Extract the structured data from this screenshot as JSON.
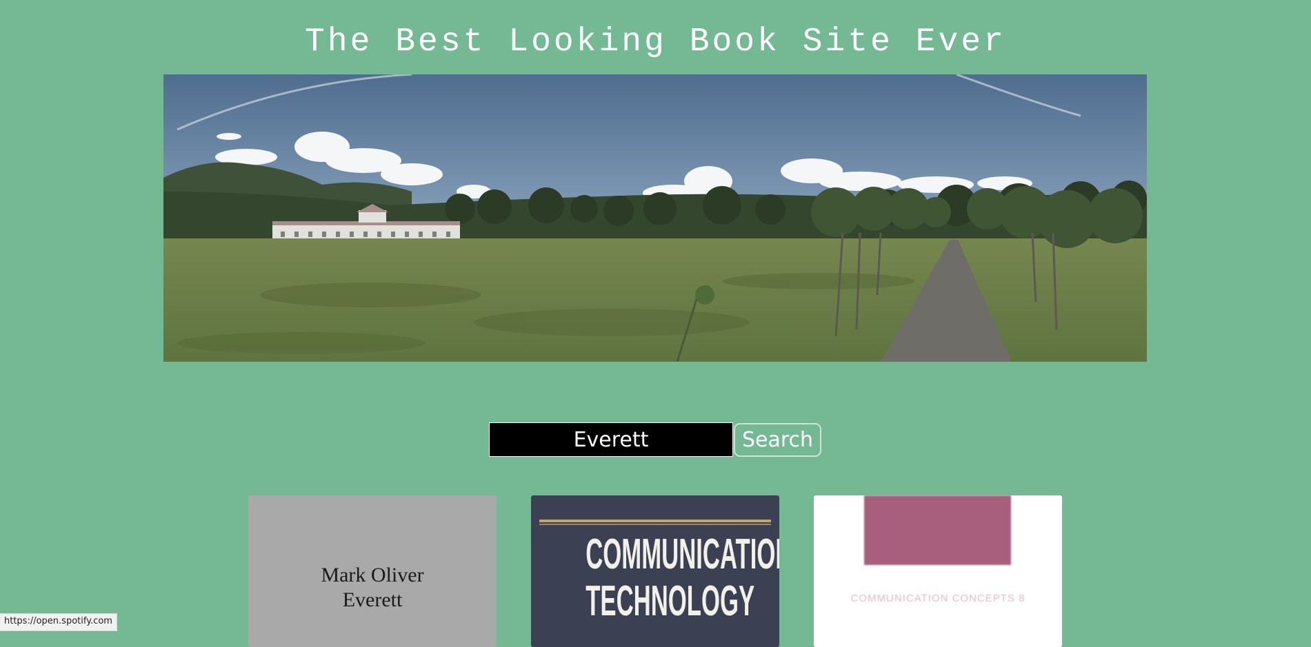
{
  "header": {
    "title": "The Best Looking Book Site Ever"
  },
  "search": {
    "value": "Everett",
    "button_label": "Search"
  },
  "results": [
    {
      "cover_text": "Mark Oliver\nEverett"
    },
    {
      "cover_text": "COMMUNICATION\nTECHNOLOGY"
    },
    {
      "cover_text": "COMMUNICATION CONCEPTS 8"
    }
  ],
  "status_bar": {
    "url": "https://open.spotify.com"
  },
  "colors": {
    "page_background": "#74b994",
    "title_text": "#ffffff",
    "search_input_background": "#000000",
    "search_button_border": "#cfe3d7"
  },
  "icons": []
}
